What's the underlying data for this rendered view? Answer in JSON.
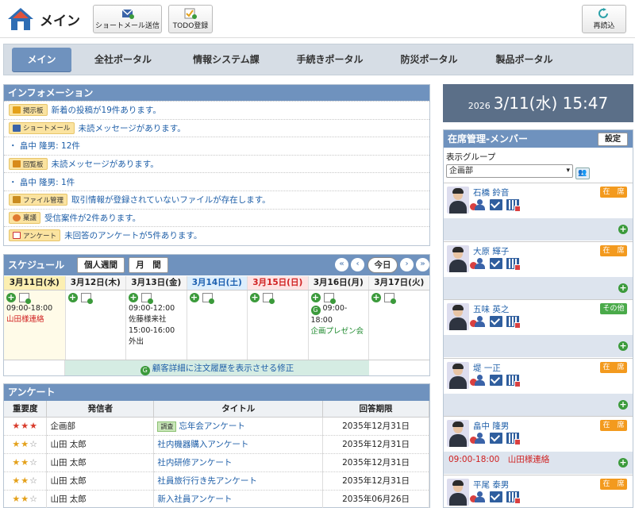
{
  "app": {
    "title": "メイン"
  },
  "toolbar": {
    "mail_label": "ショートメール送信",
    "todo_label": "TODO登録",
    "reload_label": "再読込"
  },
  "nav": {
    "tabs": [
      {
        "label": "メイン",
        "active": true
      },
      {
        "label": "全社ポータル"
      },
      {
        "label": "情報システム課"
      },
      {
        "label": "手続きポータル"
      },
      {
        "label": "防災ポータル"
      },
      {
        "label": "製品ポータル"
      }
    ]
  },
  "info": {
    "title": "インフォメーション",
    "rows": [
      {
        "tag": "掲示板",
        "tag_icon": "board-icon",
        "text": "新着の投稿が19件あります。"
      },
      {
        "tag": "ショートメール",
        "tag_icon": "mail-icon",
        "text": "未読メッセージがあります。"
      },
      {
        "tag": "",
        "text": "・ 畠中 隆男: 12件"
      },
      {
        "tag": "回覧板",
        "tag_icon": "circular-icon",
        "text": "未読メッセージがあります。"
      },
      {
        "tag": "",
        "text": "・ 畠中 隆男: 1件"
      },
      {
        "tag": "ファイル管理",
        "tag_icon": "folder-icon",
        "text": "取引情報が登録されていないファイルが存在します。"
      },
      {
        "tag": "稟議",
        "tag_icon": "approval-icon",
        "text": "受信案件が2件あります。"
      },
      {
        "tag": "アンケート",
        "tag_icon": "survey-icon",
        "text": "未回答のアンケートが5件あります。"
      }
    ]
  },
  "schedule": {
    "title": "スケジュール",
    "view_week": "個人週間",
    "view_month": "月　間",
    "today": "今日",
    "days": [
      {
        "label": "3月11日(水)",
        "kind": "today",
        "events": [
          {
            "time": "09:00-18:00",
            "title": "山田様連絡",
            "style": "red"
          }
        ]
      },
      {
        "label": "3月12日(木)",
        "kind": "weekday",
        "events": []
      },
      {
        "label": "3月13日(金)",
        "kind": "weekday",
        "events": [
          {
            "time": "09:00-12:00",
            "title": "佐藤様来社"
          },
          {
            "time": "15:00-16:00",
            "title": "外出"
          }
        ]
      },
      {
        "label": "3月14日(土)",
        "kind": "sat",
        "events": []
      },
      {
        "label": "3月15日(日)",
        "kind": "sun",
        "events": []
      },
      {
        "label": "3月16日(月)",
        "kind": "weekday",
        "events": [
          {
            "time": "09:00-18:00",
            "title": "企画プレゼン会",
            "style": "green",
            "marker": "G"
          }
        ]
      },
      {
        "label": "3月17日(火)",
        "kind": "weekday",
        "events": []
      }
    ],
    "footer_event": "顧客詳細に注文履歴を表示させる修正",
    "footer_marker": "G"
  },
  "survey": {
    "title": "アンケート",
    "headers": [
      "重要度",
      "発信者",
      "タイトル",
      "回答期限"
    ],
    "rows": [
      {
        "stars": 3,
        "sender": "企画部",
        "badge": "調査",
        "title": "忘年会アンケート",
        "due": "2035年12月31日"
      },
      {
        "stars": 2,
        "sender": "山田 太郎",
        "badge": "",
        "title": "社内機器購入アンケート",
        "due": "2035年12月31日"
      },
      {
        "stars": 2,
        "sender": "山田 太郎",
        "badge": "",
        "title": "社内研修アンケート",
        "due": "2035年12月31日"
      },
      {
        "stars": 2,
        "sender": "山田 太郎",
        "badge": "",
        "title": "社員旅行行き先アンケート",
        "due": "2035年12月31日"
      },
      {
        "stars": 2,
        "sender": "山田 太郎",
        "badge": "",
        "title": "新入社員アンケート",
        "due": "2035年06月26日"
      }
    ]
  },
  "clock": {
    "year": "2026",
    "datetime": "3/11(水) 15:47"
  },
  "presence": {
    "title": "在席管理-メンバー",
    "setting_label": "設定",
    "group_label": "表示グループ",
    "group_value": "企画部",
    "members": [
      {
        "name": "石橋 鈴音",
        "status": "在　席",
        "status_color": "#f39a1e",
        "event": ""
      },
      {
        "name": "大原 輝子",
        "status": "在　席",
        "status_color": "#f39a1e",
        "event": ""
      },
      {
        "name": "五味 英之",
        "status": "その他",
        "status_color": "#4aaa4a",
        "event": ""
      },
      {
        "name": "堤 一正",
        "status": "在　席",
        "status_color": "#f39a1e",
        "event": ""
      },
      {
        "name": "畠中 隆男",
        "status": "在　席",
        "status_color": "#f39a1e",
        "event": "09:00-18:00　山田様連絡"
      },
      {
        "name": "平尾 泰男",
        "status": "在　席",
        "status_color": "#f39a1e",
        "event": ""
      }
    ]
  }
}
